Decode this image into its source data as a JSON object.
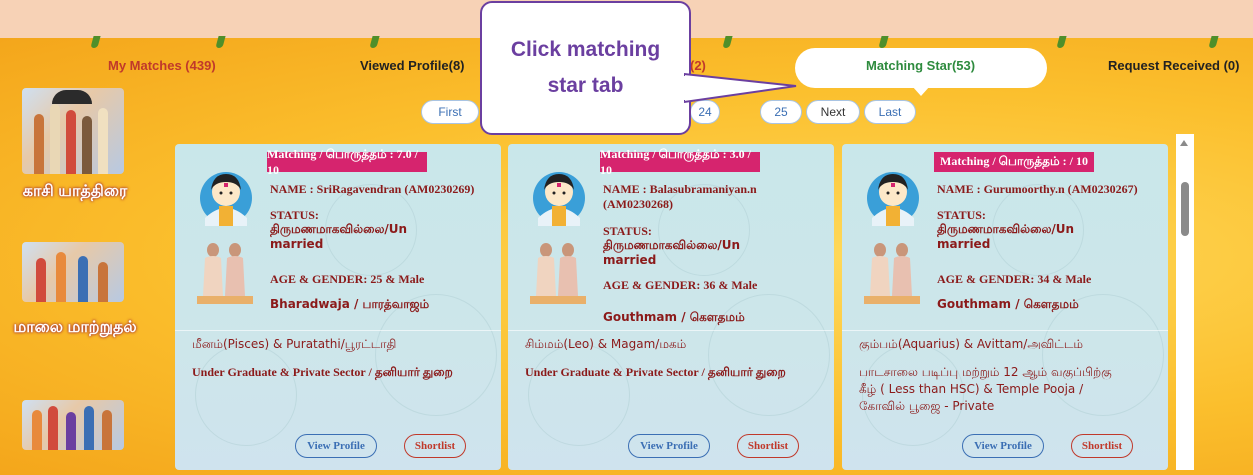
{
  "tabs": [
    {
      "label": "My Matches (439)"
    },
    {
      "label": "Viewed Profile(8)"
    },
    {
      "label": "(2)"
    },
    {
      "label": "Matching Star(53)"
    },
    {
      "label": "Request Received (0)"
    }
  ],
  "pagination": {
    "first": "First",
    "page_24": "24",
    "page_25": "25",
    "next": "Next",
    "last": "Last"
  },
  "callout": {
    "text": "Click matching star tab"
  },
  "sidebar": {
    "items": [
      {
        "label": "காசி யாத்திரை"
      },
      {
        "label": "மாலை மாற்றுதல்"
      }
    ]
  },
  "cards": [
    {
      "match": "Matching / பொருத்தம் : 7.0 / 10",
      "name": "NAME : SriRagavendran (AM0230269)",
      "status_label": "STATUS:",
      "status": "திருமணமாகவில்லை/Un married",
      "age_gender": "AGE & GENDER: 25 & Male",
      "gothram": "Bharadwaja / பாரத்வாஜம்",
      "star": "மீனம்(Pisces) & Puratathi/பூரட்டாதி",
      "education": "Under Graduate & Private Sector / தனியார் துறை",
      "view": "View Profile",
      "shortlist": "Shortlist"
    },
    {
      "match": "Matching / பொருத்தம் : 3.0 / 10",
      "name": "NAME : Balasubramaniyan.n (AM0230268)",
      "status_label": "STATUS:",
      "status": "திருமணமாகவில்லை/Un married",
      "age_gender": "AGE & GENDER: 36 & Male",
      "gothram": "Gouthmam / கௌதமம்",
      "star": "சிம்மம்(Leo) & Magam/மகம்",
      "education": "Under Graduate & Private Sector / தனியார் துறை",
      "view": "View Profile",
      "shortlist": "Shortlist"
    },
    {
      "match": "Matching / பொருத்தம் : / 10",
      "name": "NAME : Gurumoorthy.n (AM0230267)",
      "status_label": "STATUS:",
      "status": "திருமணமாகவில்லை/Un married",
      "age_gender": "AGE & GENDER: 34 & Male",
      "gothram": "Gouthmam / கௌதமம்",
      "star": "கும்பம்(Aquarius) & Avittam/அவிட்டம்",
      "education": "பாடசாலை படிப்பு மற்றும் 12 ஆம் வகுப்பிற்கு கீழ் ( Less than HSC) & Temple Pooja / கோவில் பூஜை - Private",
      "view": "View Profile",
      "shortlist": "Shortlist"
    }
  ],
  "colors": {
    "accent_badge": "#d6246e",
    "callout_border": "#6b3fa0",
    "active_tab": "#2e8b3e",
    "text_maroon": "#8b1a1a"
  }
}
